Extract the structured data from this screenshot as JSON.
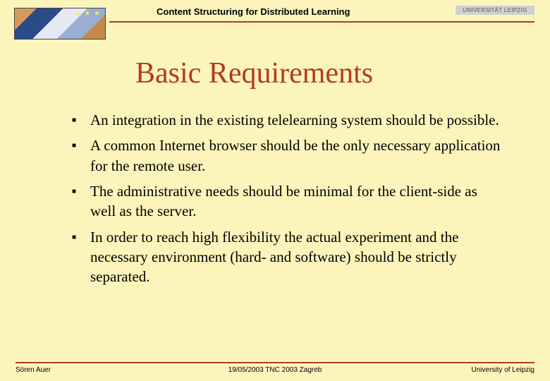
{
  "header": {
    "running_title": "Content Structuring for Distributed Learning",
    "institution_tag": "UNIVERSITÄT LEIPZIG"
  },
  "slide": {
    "title": "Basic Requirements",
    "bullets": [
      "An integration in the existing telelearning system should be possible.",
      "A common Internet browser should be the only necessary application for the remote user.",
      "The administrative needs should be minimal for the client-side as well as the server.",
      "In order to reach high flexibility the actual experiment and the necessary environment (hard- and software) should be strictly separated."
    ]
  },
  "footer": {
    "author": "Sören Auer",
    "center": "19/05/2003   TNC 2003 Zagreb",
    "affiliation": "University of Leipzig"
  },
  "colors": {
    "background": "#fbf5bb",
    "accent": "#b53a1e"
  }
}
